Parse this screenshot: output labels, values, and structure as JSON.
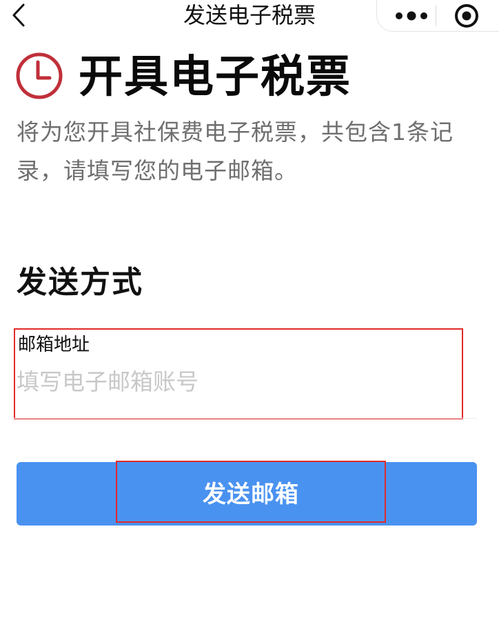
{
  "nav": {
    "title": "发送电子税票",
    "back_icon": "chevron-left-icon",
    "more_icon": "more-dots-icon",
    "close_icon": "target-close-icon"
  },
  "header": {
    "icon": "clock-icon",
    "icon_color": "#c0303a",
    "title": "开具电子税票",
    "description": "将为您开具社保费电子税票，共包含1条记录，请填写您的电子邮箱。"
  },
  "section": {
    "title": "发送方式"
  },
  "email": {
    "label": "邮箱地址",
    "value": "",
    "placeholder": "填写电子邮箱账号"
  },
  "button": {
    "label": "发送邮箱",
    "color": "#4a92f0"
  },
  "highlight_color": "#e02a2a"
}
